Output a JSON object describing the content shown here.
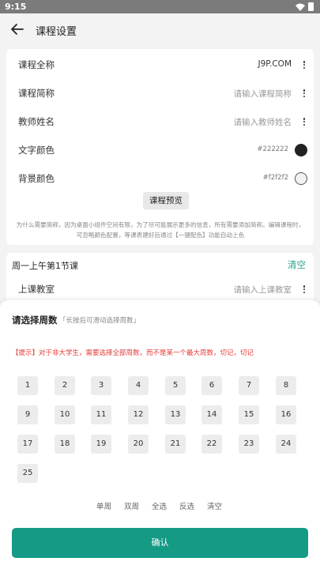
{
  "status_bar": {
    "time": "9:15"
  },
  "header": {
    "title": "课程设置"
  },
  "form": {
    "rows": [
      {
        "label": "课程全称",
        "value": "J9P.COM"
      },
      {
        "label": "课程简称",
        "value": "请输入课程简称"
      },
      {
        "label": "教师姓名",
        "value": "请输入教师姓名"
      },
      {
        "label": "文字颜色",
        "value": "#222222"
      },
      {
        "label": "背景颜色",
        "value": "#f2f2f2"
      }
    ],
    "preview_label": "课程预览",
    "notice": "为什么需要简称，因为桌面小组件空间有限，为了尽可能展示更多的信息，所有需要添加简称。编辑课程时，可忽略颜色配置，等课表建好后通过【一键配色】功能自动上色"
  },
  "section": {
    "title": "周一上午第1节课",
    "clear_label": "清空",
    "classroom_label": "上课教室",
    "classroom_placeholder": "请输入上课教室"
  },
  "sheet": {
    "title": "请选择周数",
    "subtitle": "「长按后可滑动选择周数」",
    "tip": "【提示】对于非大学生，需要选择全部周数，而不是某一个最大周数，切记，切记",
    "weeks": [
      "1",
      "2",
      "3",
      "4",
      "5",
      "6",
      "7",
      "8",
      "9",
      "10",
      "11",
      "12",
      "13",
      "14",
      "15",
      "16",
      "17",
      "18",
      "19",
      "20",
      "21",
      "22",
      "23",
      "24",
      "25"
    ],
    "actions": [
      "单周",
      "双周",
      "全选",
      "反选",
      "清空"
    ],
    "confirm_label": "确认"
  },
  "colors": {
    "accent": "#159a86",
    "link": "#1aa388",
    "tip": "#e53935",
    "text_color": "#222222",
    "bg_color": "#f2f2f2"
  }
}
